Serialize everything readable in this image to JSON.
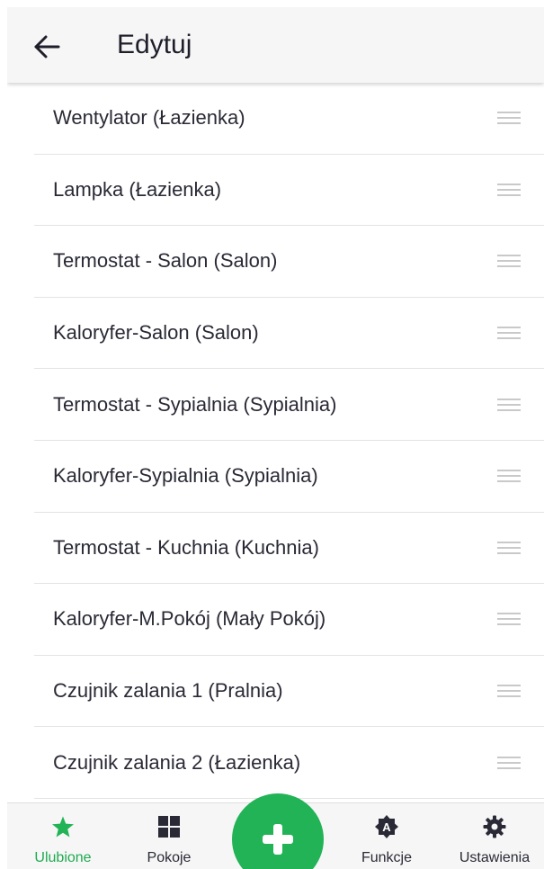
{
  "header": {
    "title": "Edytuj",
    "back_icon": "arrow-left-icon"
  },
  "list": {
    "items": [
      {
        "label": "Wentylator (Łazienka)"
      },
      {
        "label": "Lampka (Łazienka)"
      },
      {
        "label": "Termostat - Salon (Salon)"
      },
      {
        "label": "Kaloryfer-Salon (Salon)"
      },
      {
        "label": "Termostat - Sypialnia (Sypialnia)"
      },
      {
        "label": "Kaloryfer-Sypialnia (Sypialnia)"
      },
      {
        "label": "Termostat - Kuchnia (Kuchnia)"
      },
      {
        "label": "Kaloryfer-M.Pokój (Mały Pokój)"
      },
      {
        "label": "Czujnik zalania 1 (Pralnia)"
      },
      {
        "label": "Czujnik zalania 2 (Łazienka)"
      }
    ]
  },
  "bottom_nav": {
    "items": [
      {
        "label": "Ulubione",
        "icon": "star-icon",
        "active": true
      },
      {
        "label": "Pokoje",
        "icon": "grid-icon",
        "active": false
      },
      {
        "label": "Funkcje",
        "icon": "automation-badge-icon",
        "active": false
      },
      {
        "label": "Ustawienia",
        "icon": "gear-icon",
        "active": false
      }
    ],
    "fab_icon": "plus-icon"
  },
  "colors": {
    "accent": "#21b356",
    "active_label": "#1faa52",
    "text": "#2a2a36",
    "bar_background": "#f6f6f6",
    "divider": "#e3e3e3"
  }
}
